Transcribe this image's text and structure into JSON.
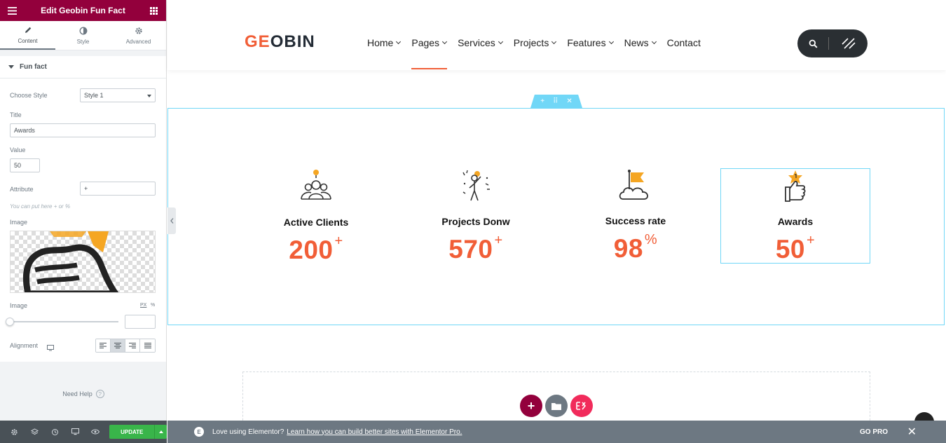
{
  "panel": {
    "title": "Edit Geobin Fun Fact",
    "tabs": [
      "Content",
      "Style",
      "Advanced"
    ],
    "section_title": "Fun fact",
    "choose_style_label": "Choose Style",
    "choose_style_value": "Style 1",
    "title_label": "Title",
    "title_value": "Awards",
    "value_label": "Value",
    "value_value": "50",
    "attribute_label": "Attribute",
    "attribute_value": "+",
    "attribute_hint": "You can put here + or %",
    "image_label": "Image",
    "image_size_label": "Image",
    "units_px": "PX",
    "units_pct": "%",
    "alignment_label": "Alignment",
    "need_help": "Need Help",
    "update_label": "UPDATE"
  },
  "site": {
    "logo_part1": "GE",
    "logo_part2": "O",
    "logo_part3": "BIN",
    "nav": [
      "Home",
      "Pages",
      "Services",
      "Projects",
      "Features",
      "News",
      "Contact"
    ],
    "nav_has_dropdown": [
      true,
      true,
      true,
      true,
      true,
      true,
      false
    ],
    "active_nav": "Pages"
  },
  "fun_facts": [
    {
      "title": "Active Clients",
      "value": "200",
      "suffix": "+",
      "icon": "users-icon"
    },
    {
      "title": "Projects Donw",
      "value": "570",
      "suffix": "+",
      "icon": "astronaut-icon"
    },
    {
      "title": "Success rate",
      "value": "98",
      "suffix": "%",
      "icon": "cloud-flag-icon"
    },
    {
      "title": "Awards",
      "value": "50",
      "suffix": "+",
      "icon": "thumbs-up-award-icon"
    }
  ],
  "promo": {
    "text": "Love using Elementor?",
    "link": "Learn how you can build better sites with Elementor Pro.",
    "go_pro": "GO PRO"
  },
  "colors": {
    "brand_maroon": "#93003c",
    "accent_orange": "#f15e37",
    "editor_cyan": "#71d7f7",
    "update_green": "#39b54a"
  }
}
